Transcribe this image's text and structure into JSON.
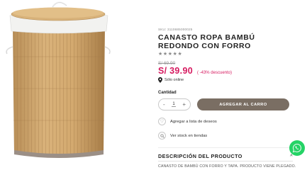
{
  "product": {
    "sku": "SKU: 3110685000025",
    "title": "CANASTO ROPA BAMBÚ REDONDO CON FORRO",
    "rating_stars": "★★★★★",
    "rating": 5,
    "old_price": "S/ 69.90",
    "price": "S/ 39.90",
    "discount": "( -43% descuento)",
    "availability": "Sólo online",
    "image_icon": "bamboo-laundry-basket"
  },
  "purchase": {
    "qty_label": "Cantidad",
    "qty_minus": "-",
    "qty_value": "1",
    "qty_plus": "+",
    "add_to_cart": "AGREGAR AL CARRO"
  },
  "actions": {
    "wishlist": "Agregar a lista de deseos",
    "stock": "Ver stock en tiendas"
  },
  "description": {
    "heading": "DESCRIPCIÓN DEL PRODUCTO",
    "toggle": "^",
    "text": "CANASTO DE BAMBÚ CON FORRO Y TAPA. PRODUCTO VIENE PLEGADO."
  },
  "colors": {
    "price": "#d6195f",
    "cart_button": "#7a6e63",
    "whatsapp": "#25d366"
  }
}
